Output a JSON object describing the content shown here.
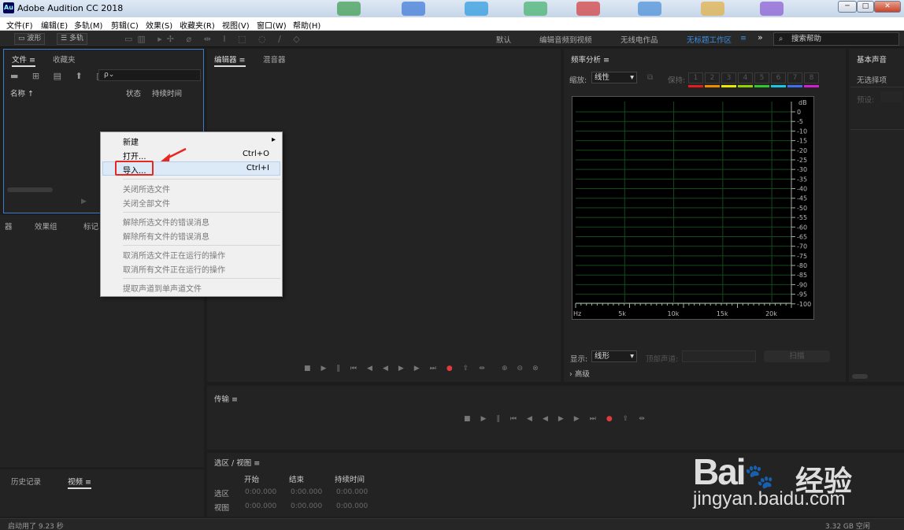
{
  "window": {
    "title": "Adobe Audition CC 2018",
    "logo": "Au",
    "minimize": "─",
    "maximize": "□",
    "close": "✕"
  },
  "menubar": [
    "文件(F)",
    "编辑(E)",
    "多轨(M)",
    "剪辑(C)",
    "效果(S)",
    "收藏夹(R)",
    "视图(V)",
    "窗口(W)",
    "帮助(H)"
  ],
  "toolbar": {
    "waveform": "波形",
    "multitrack": "多轨"
  },
  "workspaces": [
    "默认",
    "编辑音频到视频",
    "无线电作品",
    "无标题工作区"
  ],
  "workspace_more": "»",
  "search_placeholder": "搜索帮助",
  "files_panel": {
    "tab_files": "文件",
    "tab_favorites": "收藏夹",
    "col_name": "名称",
    "col_status": "状态",
    "col_duration": "持续时间",
    "search_icon": "ρ⌄"
  },
  "left_tabs": {
    "t1": "器",
    "t2": "效果组",
    "t3": "标记"
  },
  "context_menu": {
    "new": "新建",
    "open": "打开...",
    "open_sc": "Ctrl+O",
    "import": "导入...",
    "import_sc": "Ctrl+I",
    "close_sel": "关闭所选文件",
    "close_all": "关闭全部文件",
    "clear_sel_err": "解除所选文件的错误消息",
    "clear_all_err": "解除所有文件的错误消息",
    "cancel_sel": "取消所选文件正在运行的操作",
    "cancel_all": "取消所有文件正在运行的操作",
    "extract": "提取声道到单声道文件"
  },
  "editor": {
    "tab_editor": "编辑器",
    "tab_mixer": "混音器"
  },
  "frequency": {
    "title": "频率分析",
    "zoom_label": "缩放:",
    "zoom_value": "线性",
    "hold_label": "保持:",
    "hold_buttons": [
      "1",
      "2",
      "3",
      "4",
      "5",
      "6",
      "7",
      "8"
    ],
    "hold_colors": [
      "#e21c1c",
      "#f08a00",
      "#e8e800",
      "#8fd400",
      "#2fc82f",
      "#19c6e6",
      "#3f6ff0",
      "#d11fd1"
    ],
    "db_labels": [
      "dB",
      "0",
      "-5",
      "-10",
      "-15",
      "-20",
      "-25",
      "-30",
      "-35",
      "-40",
      "-45",
      "-50",
      "-55",
      "-60",
      "-65",
      "-70",
      "-75",
      "-80",
      "-85",
      "-90",
      "-95",
      "-100"
    ],
    "hz_labels": [
      "Hz",
      "5k",
      "10k",
      "15k",
      "20k"
    ],
    "display_label": "显示:",
    "display_value": "线形",
    "top_channel_label": "顶部声道:",
    "scan": "扫描",
    "advanced": "高级"
  },
  "basic_sound": {
    "title": "基本声音",
    "no_selection": "无选择项",
    "preset": "预设:"
  },
  "transport": {
    "title": "传输"
  },
  "selection": {
    "title": "选区 / 视图",
    "col_start": "开始",
    "col_end": "结束",
    "col_duration": "持续时间",
    "row_selection": "选区",
    "row_view": "视图",
    "zero": "0:00.000"
  },
  "bottom_left": {
    "history": "历史记录",
    "video": "视频"
  },
  "status": {
    "left": "启动用了 9.23 秒",
    "right": "3.32 GB 空闲"
  },
  "watermark": {
    "brand": "Bai",
    "brand2": "经验",
    "url": "jingyan.baidu.com"
  }
}
